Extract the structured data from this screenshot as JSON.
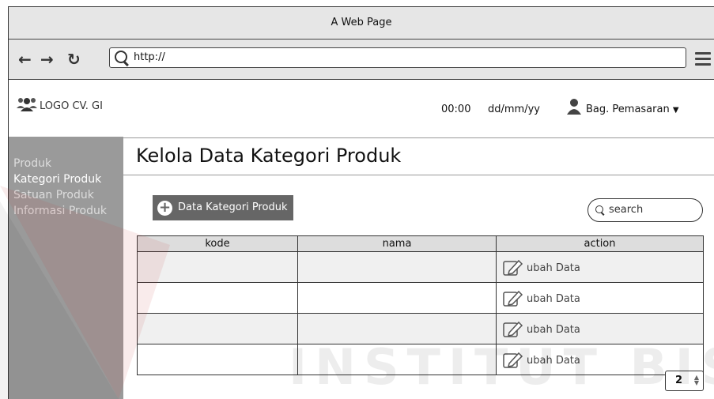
{
  "window": {
    "title": "A Web Page"
  },
  "browser": {
    "url": "http://"
  },
  "header": {
    "logo_text": "LOGO CV. GI",
    "time": "00:00",
    "date": "dd/mm/yy",
    "user": "Bag. Pemasaran"
  },
  "sidebar": {
    "items": [
      {
        "label": "Produk"
      },
      {
        "label": "Kategori Produk"
      },
      {
        "label": "Satuan Produk"
      },
      {
        "label": "Informasi Produk"
      }
    ]
  },
  "main": {
    "title": "Kelola Data Kategori Produk",
    "add_button": "Data Kategori Produk",
    "search_placeholder": "search",
    "table": {
      "columns": [
        "kode",
        "nama",
        "action"
      ],
      "action_label": "ubah Data",
      "rows": [
        {
          "kode": "",
          "nama": ""
        },
        {
          "kode": "",
          "nama": ""
        },
        {
          "kode": "",
          "nama": ""
        },
        {
          "kode": "",
          "nama": ""
        }
      ]
    },
    "pagination": {
      "page": "2"
    }
  },
  "watermark": "INSTITUT BISNIS",
  "colors": {
    "sidebar_bg": "#9a9a9a",
    "button_bg": "#666666",
    "chrome_bg": "#e6e6e6"
  }
}
